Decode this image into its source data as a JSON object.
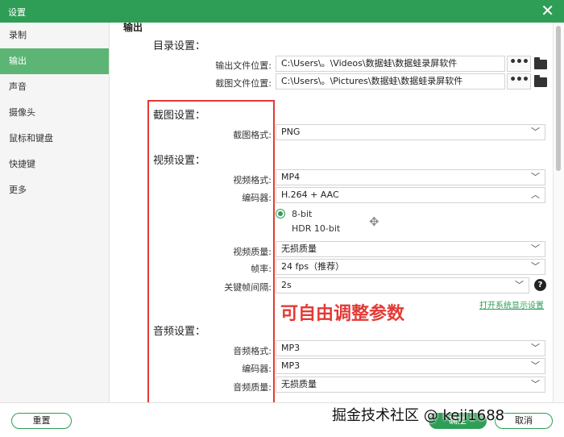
{
  "window": {
    "title": "设置",
    "close_icon": "close-icon",
    "accent": "#2e9e56"
  },
  "sidebar": {
    "items": [
      {
        "label": "录制",
        "active": false
      },
      {
        "label": "输出",
        "active": true
      },
      {
        "label": "声音",
        "active": false
      },
      {
        "label": "摄像头",
        "active": false
      },
      {
        "label": "鼠标和键盘",
        "active": false
      },
      {
        "label": "快捷键",
        "active": false
      },
      {
        "label": "更多",
        "active": false
      }
    ]
  },
  "output": {
    "heading": "输出",
    "directory": {
      "title": "目录设置：",
      "output_label": "输出文件位置:",
      "output_value": "C:\\Users\\。\\Videos\\数据蛙\\数据蛙录屏软件",
      "screenshot_label": "截图文件位置:",
      "screenshot_value": "C:\\Users\\。\\Pictures\\数据蛙\\数据蛙录屏软件",
      "browse": "•••"
    },
    "screenshot": {
      "title": "截图设置：",
      "format_label": "截图格式:",
      "format_value": "PNG"
    },
    "video": {
      "title": "视频设置：",
      "format_label": "视频格式:",
      "format_value": "MP4",
      "encoder_label": "编码器:",
      "encoder_value": "H.264 + AAC",
      "bit_options": [
        "8-bit",
        "HDR 10-bit"
      ],
      "bit_selected": "8-bit",
      "quality_label": "视频质量:",
      "quality_value": "无损质量",
      "fps_label": "帧率:",
      "fps_value": "24 fps（推荐）",
      "keyframe_label": "关键帧间隔:",
      "keyframe_value": "2s",
      "help": "?",
      "display_link": "打开系统显示设置"
    },
    "audio": {
      "title": "音频设置：",
      "format_label": "音频格式:",
      "format_value": "MP3",
      "encoder_label": "编码器:",
      "encoder_value": "MP3",
      "quality_label": "音频质量:",
      "quality_value": "无损质量"
    }
  },
  "annotation": {
    "note": "可自由调整参数",
    "color": "#e53935"
  },
  "footer": {
    "reset": "重置",
    "ok": "确定",
    "cancel": "取消"
  },
  "watermark": "掘金技术社区 @ keji1688"
}
